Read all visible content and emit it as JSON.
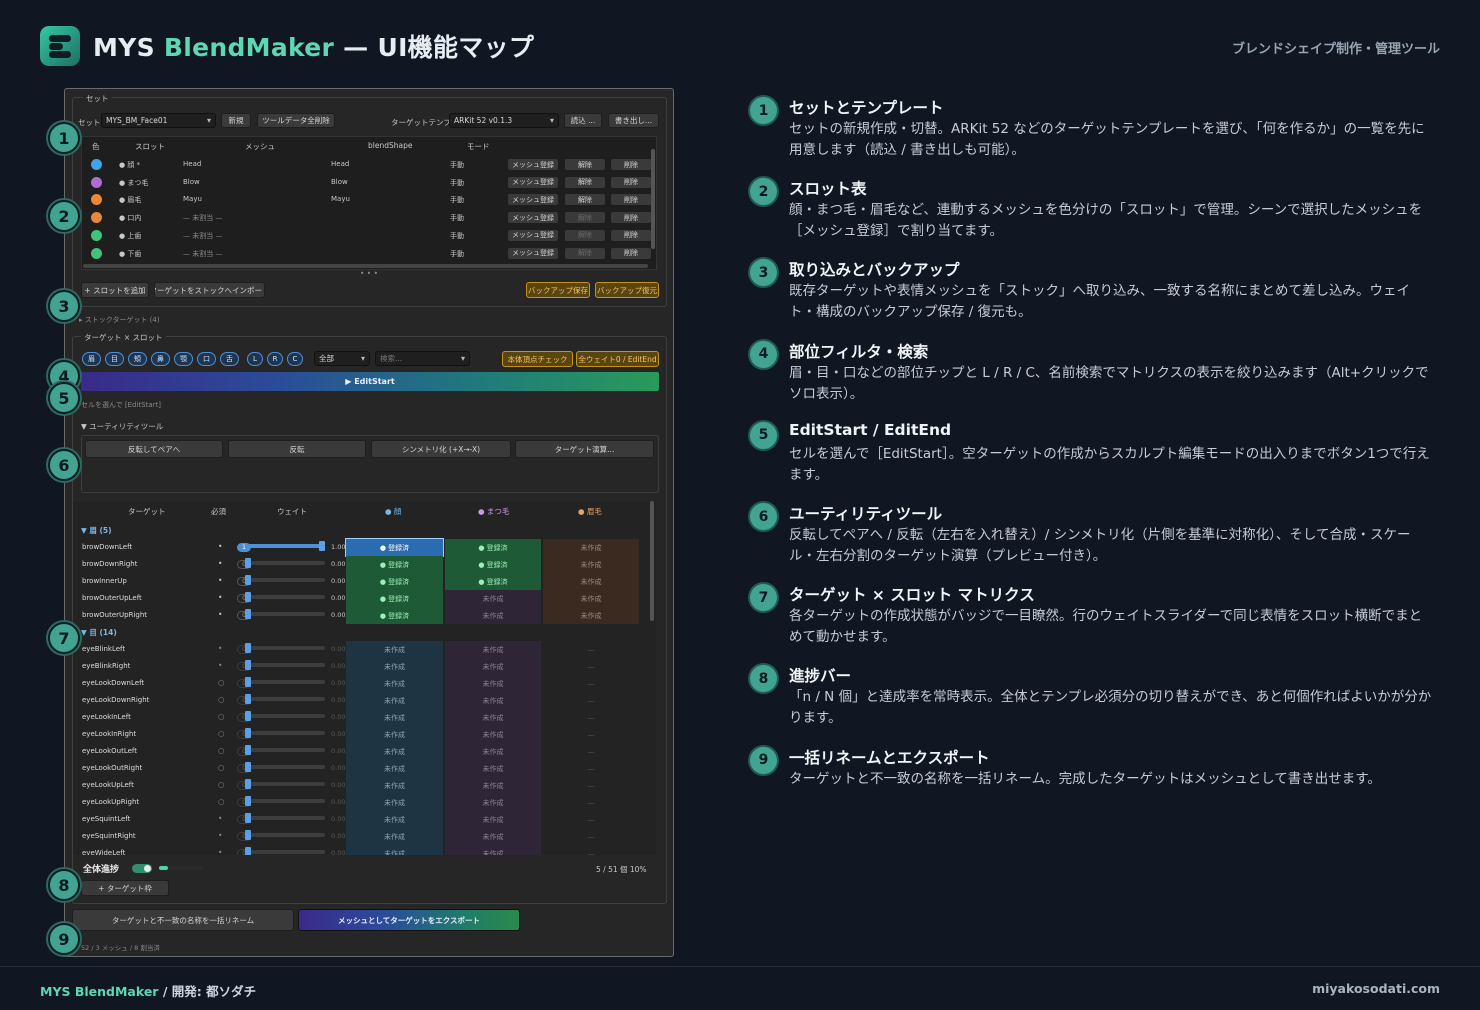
{
  "header": {
    "title_pre": "MYS ",
    "title_brand": "BlendMaker",
    "title_post": " — UI機能マップ",
    "tagline": "ブレンドシェイプ制作・管理ツール"
  },
  "footer": {
    "brand": "MYS BlendMaker",
    "dev": " / 開発: 都ソダチ",
    "site": "miyakosodati.com"
  },
  "panel": {
    "set_header": "セット",
    "set_label": "セット",
    "set_value": "MYS_BM_Face01",
    "btn_new": "新規",
    "btn_clear_tool": "ツールデータ全削除",
    "tmpl_label": "ターゲットテンプレ",
    "tmpl_value": "ARKit 52  v0.1.3",
    "btn_load": "読込 ...",
    "btn_export_tmpl": "書き出し...",
    "slot_cols": [
      "色",
      "スロット",
      "メッシュ",
      "blendShape",
      "モード"
    ],
    "slots": [
      {
        "color": "#3fa3e8",
        "name": "● 顔 *",
        "mesh": "Head",
        "bs": "Head",
        "mode": "手動",
        "b1": "メッシュ登録",
        "b2": "解除",
        "b3": "削除",
        "b2dim": false
      },
      {
        "color": "#b06cd6",
        "name": "● まつ毛",
        "mesh": "Blow",
        "bs": "Blow",
        "mode": "手動",
        "b1": "メッシュ登録",
        "b2": "解除",
        "b3": "削除",
        "b2dim": false
      },
      {
        "color": "#e8883a",
        "name": "● 眉毛",
        "mesh": "Mayu",
        "bs": "Mayu",
        "mode": "手動",
        "b1": "メッシュ登録",
        "b2": "解除",
        "b3": "削除",
        "b2dim": false
      },
      {
        "color": "#e8883a",
        "name": "● 口内",
        "mesh": "— 未割当 —",
        "bs": "",
        "mode": "手動",
        "b1": "メッシュ登録",
        "b2": "解除",
        "b3": "削除",
        "b2dim": true
      },
      {
        "color": "#44c27a",
        "name": "● 上歯",
        "mesh": "— 未割当 —",
        "bs": "",
        "mode": "手動",
        "b1": "メッシュ登録",
        "b2": "解除",
        "b3": "削除",
        "b2dim": true
      },
      {
        "color": "#44c27a",
        "name": "● 下歯",
        "mesh": "— 未割当 —",
        "bs": "",
        "mode": "手動",
        "b1": "メッシュ登録",
        "b2": "解除",
        "b3": "削除",
        "b2dim": true
      }
    ],
    "btn_add_slot": "+ スロットを追加",
    "btn_import_stock": "ターゲットをストックへインポート",
    "btn_backup_save": "バックアップ保存",
    "btn_backup_restore": "バックアップ復元",
    "stock_label": "▸ ストックターゲット (4)",
    "matrix_header": "ターゲット × スロット",
    "chips": [
      "眉",
      "目",
      "頬",
      "鼻",
      "顎",
      "口",
      "舌"
    ],
    "lrc": [
      "L",
      "R",
      "C"
    ],
    "filter_value": "全部",
    "search_placeholder": "検索...",
    "btn_vertex_check": "本体頂点チェック",
    "btn_all_weight": "全ウェイト0 / EditEnd",
    "editstart": "▶ EditStart",
    "editstart_hint": "セルを選んで [EditStart]",
    "utility_label": "▼ ユーティリティツール",
    "util_buttons": [
      "反転してペアへ",
      "反転",
      "シンメトリ化 (+X→-X)",
      "ターゲット演算..."
    ],
    "mx_cols": {
      "target": "ターゲット",
      "required": "必須",
      "weight": "ウェイト",
      "s1": "● 顔",
      "s2": "● まつ毛",
      "s3": "● 眉毛"
    },
    "group1": "▼ 眉 (5)",
    "group2": "▼ 目 (14)",
    "brow_rows": [
      {
        "name": "browDownLeft",
        "req": "•",
        "w": "1",
        "val": "1.00",
        "fill": 1.0,
        "c1": "● 登録済",
        "c2": "● 登録済",
        "c3": "未作成"
      },
      {
        "name": "browDownRight",
        "req": "•",
        "w": "0",
        "val": "0.00",
        "fill": 0,
        "c1": "● 登録済",
        "c2": "● 登録済",
        "c3": "未作成"
      },
      {
        "name": "browInnerUp",
        "req": "•",
        "w": "0",
        "val": "0.00",
        "fill": 0,
        "c1": "● 登録済",
        "c2": "● 登録済",
        "c3": "未作成"
      },
      {
        "name": "browOuterUpLeft",
        "req": "•",
        "w": "0",
        "val": "0.00",
        "fill": 0,
        "c1": "● 登録済",
        "c2": "未作成",
        "c3": "未作成"
      },
      {
        "name": "browOuterUpRight",
        "req": "•",
        "w": "0",
        "val": "0.00",
        "fill": 0,
        "c1": "● 登録済",
        "c2": "未作成",
        "c3": "未作成"
      }
    ],
    "eye_rows": [
      {
        "name": "eyeBlinkLeft",
        "req": "•"
      },
      {
        "name": "eyeBlinkRight",
        "req": "•"
      },
      {
        "name": "eyeLookDownLeft",
        "req": "○"
      },
      {
        "name": "eyeLookDownRight",
        "req": "○"
      },
      {
        "name": "eyeLookInLeft",
        "req": "○"
      },
      {
        "name": "eyeLookInRight",
        "req": "○"
      },
      {
        "name": "eyeLookOutLeft",
        "req": "○"
      },
      {
        "name": "eyeLookOutRight",
        "req": "○"
      },
      {
        "name": "eyeLookUpLeft",
        "req": "○"
      },
      {
        "name": "eyeLookUpRight",
        "req": "○"
      },
      {
        "name": "eyeSquintLeft",
        "req": "•"
      },
      {
        "name": "eyeSquintRight",
        "req": "•"
      },
      {
        "name": "eyeWideLeft",
        "req": "•"
      }
    ],
    "eye_weight": "0",
    "eye_val": "0.00",
    "not_made": "未作成",
    "dash": "—",
    "progress_label": "全体進捗",
    "progress_text": "5 / 51 個  10%",
    "progress_fraction": 0.1,
    "btn_target_label": "+ ターゲット枠",
    "btn_rename": "ターゲットと不一致の名称を一括リネーム",
    "btn_export_mesh": "メッシュとしてターゲットをエクスポート",
    "status": "52 / 3 メッシュ / 8 割当済"
  },
  "items": [
    {
      "n": "1",
      "title": "セットとテンプレート",
      "desc": "セットの新規作成・切替。ARKit 52 などのターゲットテンプレートを選び、「何を作るか」の一覧を先に用意します（読込 / 書き出しも可能）。"
    },
    {
      "n": "2",
      "title": "スロット表",
      "desc": "顔・まつ毛・眉毛など、連動するメッシュを色分けの「スロット」で管理。シーンで選択したメッシュを［メッシュ登録］で割り当てます。"
    },
    {
      "n": "3",
      "title": "取り込みとバックアップ",
      "desc": "既存ターゲットや表情メッシュを「ストック」へ取り込み、一致する名称にまとめて差し込み。ウェイト・構成のバックアップ保存 / 復元も。"
    },
    {
      "n": "4",
      "title": "部位フィルタ・検索",
      "desc": "眉・目・口などの部位チップと L / R / C、名前検索でマトリクスの表示を絞り込みます（Alt+クリックでソロ表示）。"
    },
    {
      "n": "5",
      "title": "EditStart / EditEnd",
      "desc": "セルを選んで［EditStart］。空ターゲットの作成からスカルプト編集モードの出入りまでボタン1つで行えます。"
    },
    {
      "n": "6",
      "title": "ユーティリティツール",
      "desc": "反転してペアへ / 反転（左右を入れ替え）/ シンメトリ化（片側を基準に対称化）、そして合成・スケール・左右分割のターゲット演算（プレビュー付き）。"
    },
    {
      "n": "7",
      "title": "ターゲット × スロット マトリクス",
      "desc": "各ターゲットの作成状態がバッジで一目瞭然。行のウェイトスライダーで同じ表情をスロット横断でまとめて動かせます。"
    },
    {
      "n": "8",
      "title": "進捗バー",
      "desc": "「n / N 個」と達成率を常時表示。全体とテンプレ必須分の切り替えができ、あと何個作ればよいかが分かります。"
    },
    {
      "n": "9",
      "title": "一括リネームとエクスポート",
      "desc": "ターゲットと不一致の名称を一括リネーム。完成したターゲットはメッシュとして書き出せます。"
    }
  ],
  "badges": [
    "1",
    "2",
    "3",
    "4",
    "5",
    "6",
    "7",
    "8",
    "9"
  ],
  "colors": {
    "accent": "#5fd6b4",
    "badge": "#43a393",
    "registered": "#1f5a36",
    "not_made_face": "#1e3442",
    "not_made_lash": "#2e2636",
    "not_made_brow": "#3a2a20"
  }
}
